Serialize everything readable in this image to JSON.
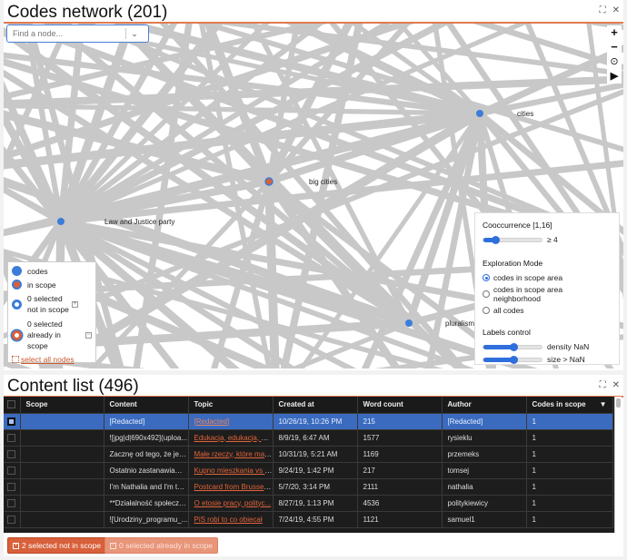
{
  "network_panel": {
    "title": "Codes network (201)",
    "search_placeholder": "Find a node...",
    "zoom_controls": {
      "zoom_in": "+",
      "zoom_out": "−",
      "center": "⊙",
      "play": "▶"
    },
    "nodes": [
      {
        "label": "cities",
        "state": "code"
      },
      {
        "label": "big cities",
        "state": "in-scope"
      },
      {
        "label": "Law and Justice party",
        "state": "code"
      },
      {
        "label": "pluralism",
        "state": "code"
      }
    ],
    "legend": {
      "codes": "codes",
      "in_scope": "in scope",
      "selected_not_in_scope_line1": "0 selected",
      "selected_not_in_scope_line2": "not in scope",
      "selected_in_scope_line1": "0 selected",
      "selected_in_scope_line2": "already in scope",
      "select_all": "select all nodes"
    },
    "controls": {
      "cooccurrence_title": "Cooccurrence [1,16]",
      "cooccurrence_value": "≥ 4",
      "cooccurrence_level": 0.2,
      "exploration_title": "Exploration Mode",
      "modes": [
        {
          "label": "codes in scope area",
          "selected": true
        },
        {
          "label": "codes in scope area neighborhood",
          "selected": false
        },
        {
          "label": "all codes",
          "selected": false
        }
      ],
      "labels_title": "Labels control",
      "density_label": "density NaN",
      "density_level": 0.5,
      "size_label": "size > NaN",
      "size_level": 0.5
    },
    "colors": {
      "code": "#3b7dd8",
      "in_scope": "#d8603a",
      "edge": "#c8c8c8"
    }
  },
  "content_panel": {
    "title": "Content list (496)",
    "columns": [
      "Scope",
      "Content",
      "Topic",
      "Created at",
      "Word count",
      "Author",
      "Codes in scope"
    ],
    "sort_indicator": "▼",
    "rows": [
      {
        "selected": true,
        "scope": "",
        "content": "[Redacted]",
        "topic": "[Redacted]",
        "created": "10/26/19, 10:26 PM",
        "words": "215",
        "author": "[Redacted]",
        "codes": "1"
      },
      {
        "selected": false,
        "scope": "",
        "content": "![jpg|d|690x492](uploa...",
        "topic": "Edukacja, edukacja, ed...",
        "created": "8/9/19, 6:47 AM",
        "words": "1577",
        "author": "rysieklu",
        "codes": "1"
      },
      {
        "selected": false,
        "scope": "",
        "content": "Zacznę od tego, że jest...",
        "topic": "Małe rzeczy, które maj...",
        "created": "10/31/19, 5:21 AM",
        "words": "1169",
        "author": "przemeks",
        "codes": "1"
      },
      {
        "selected": false,
        "scope": "",
        "content": "Ostatnio zastanawiam ...",
        "topic": "Kupno mieszkania vs d...",
        "created": "9/24/19, 1:42 PM",
        "words": "217",
        "author": "tomsej",
        "codes": "1"
      },
      {
        "selected": false,
        "scope": "",
        "content": "I'm Nathalia and I'm tur...",
        "topic": "Postcard from Brussels...",
        "created": "5/7/20, 3:14 PM",
        "words": "2111",
        "author": "nathalia",
        "codes": "1"
      },
      {
        "selected": false,
        "scope": "",
        "content": "**Działalność społeczn...",
        "topic": "O etosie pracy, polityc...",
        "created": "8/27/19, 1:13 PM",
        "words": "4536",
        "author": "politykiewicy",
        "codes": "1"
      },
      {
        "selected": false,
        "scope": "",
        "content": "![Urodziny_programu_...",
        "topic": "PiS robi to co obiecał",
        "created": "7/24/19, 4:55 PM",
        "words": "1121",
        "author": "samuel1",
        "codes": "1"
      }
    ],
    "footer": {
      "add_button": "2 selected not in scope",
      "remove_button": "0 selected already in scope"
    }
  }
}
